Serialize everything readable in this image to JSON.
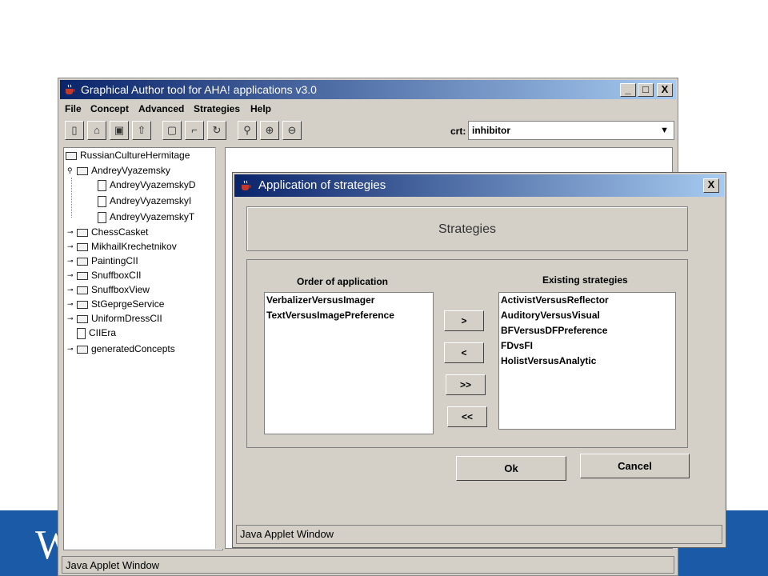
{
  "main_window": {
    "title": "Graphical Author tool for AHA! applications v3.0",
    "window_controls": [
      "_",
      "□",
      "X"
    ],
    "menu": [
      "File",
      "Concept",
      "Advanced",
      "Strategies",
      "Help"
    ],
    "crt_label": "crt:",
    "crt_value": "inhibitor",
    "tree": {
      "root": "RussianCultureHermitage",
      "expanded": "AndreyVyazemsky",
      "children": [
        "AndreyVyazemskyD",
        "AndreyVyazemskyI",
        "AndreyVyazemskyT"
      ],
      "collapsed": [
        "ChessCasket",
        "MikhailKrechetnikov",
        "PaintingCII",
        "SnuffboxCII",
        "SnuffboxView",
        "StGeprgeService",
        "UniformDressCII"
      ],
      "leaf": "CIIEra",
      "last": "generatedConcepts"
    },
    "status": "Java Applet Window"
  },
  "dialog": {
    "title": "Application of strategies",
    "close": "X",
    "header": "Strategies",
    "left_header": "Order of application",
    "right_header": "Existing strategies",
    "applied": [
      "VerbalizerVersusImager",
      "TextVersusImagePreference"
    ],
    "existing": [
      "ActivistVersusReflector",
      "AuditoryVersusVisual",
      "BFVersusDFPreference",
      "FDvsFI",
      "HolistVersusAnalytic"
    ],
    "move_buttons": [
      ">",
      "<",
      ">>",
      "<<"
    ],
    "ok": "Ok",
    "cancel": "Cancel",
    "status": "Java Applet Window"
  },
  "colors": {
    "titlebar_start": "#0a246a",
    "titlebar_end": "#a6caf0",
    "slide_band": "#1a5aa6"
  }
}
